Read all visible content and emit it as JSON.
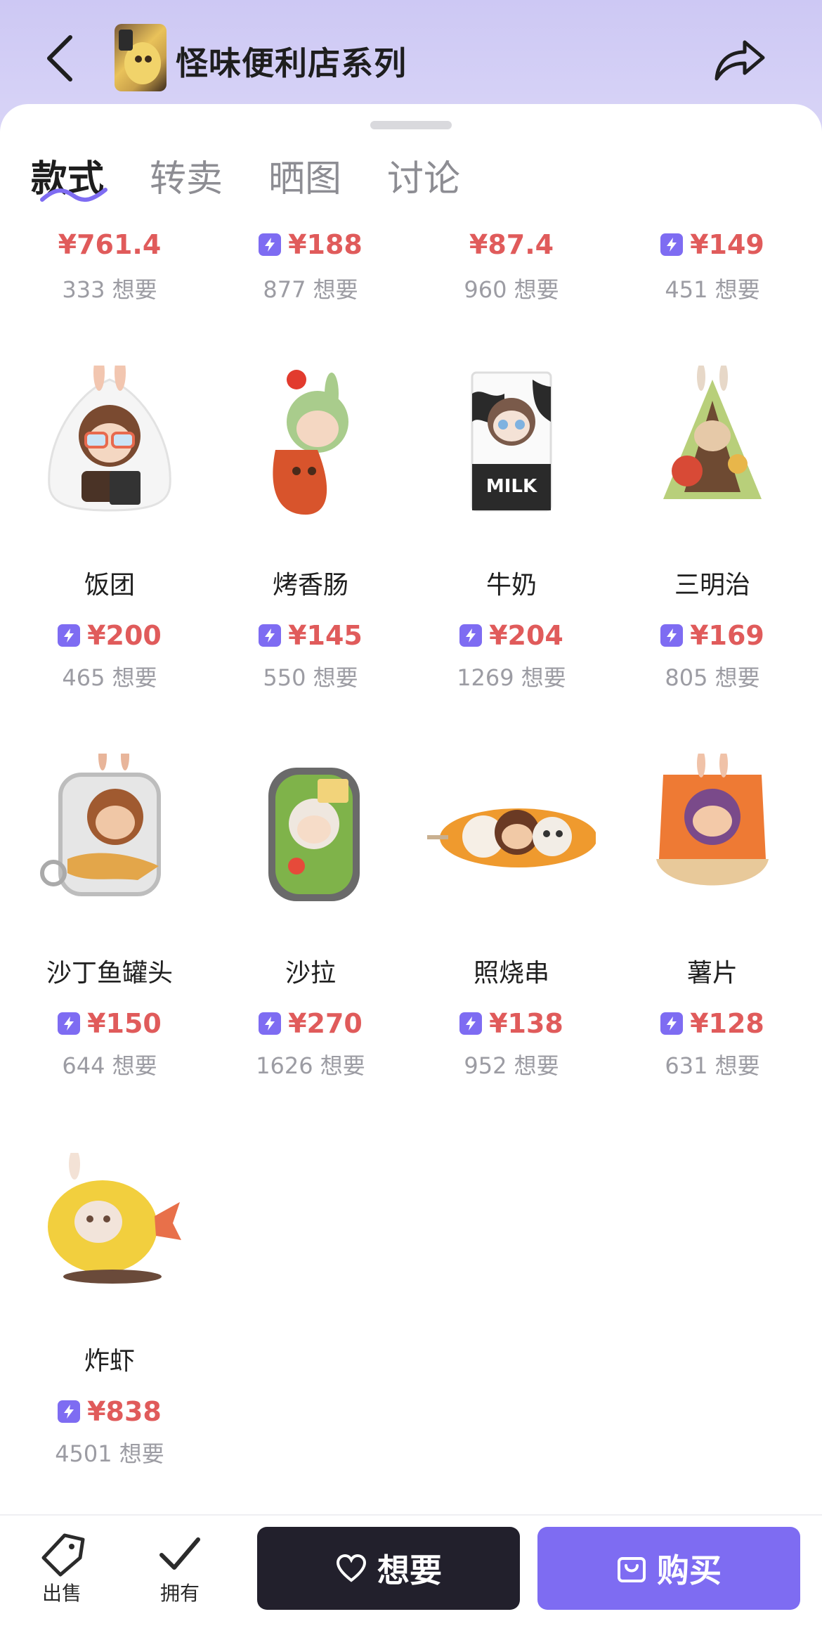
{
  "header": {
    "title": "怪味便利店系列",
    "back_icon": "chevron-left-icon",
    "share_icon": "share-arrow-icon"
  },
  "tabs": [
    {
      "label": "款式",
      "active": true
    },
    {
      "label": "转卖",
      "active": false
    },
    {
      "label": "晒图",
      "active": false
    },
    {
      "label": "讨论",
      "active": false
    }
  ],
  "colors": {
    "accent": "#7e6cf2",
    "price": "#e05b5b",
    "dark_button": "#22202c",
    "header_bg": "#cdc8f4"
  },
  "partial_row": [
    {
      "price": "¥761.4",
      "flash": false,
      "want": "333 想要"
    },
    {
      "price": "¥188",
      "flash": true,
      "want": "877 想要"
    },
    {
      "price": "¥87.4",
      "flash": false,
      "want": "960 想要"
    },
    {
      "price": "¥149",
      "flash": true,
      "want": "451 想要"
    }
  ],
  "products": [
    {
      "name": "饭团",
      "price": "¥200",
      "flash": true,
      "want": "465 想要"
    },
    {
      "name": "烤香肠",
      "price": "¥145",
      "flash": true,
      "want": "550 想要"
    },
    {
      "name": "牛奶",
      "price": "¥204",
      "flash": true,
      "want": "1269 想要"
    },
    {
      "name": "三明治",
      "price": "¥169",
      "flash": true,
      "want": "805 想要"
    },
    {
      "name": "沙丁鱼罐头",
      "price": "¥150",
      "flash": true,
      "want": "644 想要"
    },
    {
      "name": "沙拉",
      "price": "¥270",
      "flash": true,
      "want": "1626 想要"
    },
    {
      "name": "照烧串",
      "price": "¥138",
      "flash": true,
      "want": "952 想要"
    },
    {
      "name": "薯片",
      "price": "¥128",
      "flash": true,
      "want": "631 想要"
    },
    {
      "name": "炸虾",
      "price": "¥838",
      "flash": true,
      "want": "4501 想要"
    }
  ],
  "bottom_bar": {
    "sell_label": "出售",
    "own_label": "拥有",
    "want_label": "想要",
    "buy_label": "购买"
  }
}
